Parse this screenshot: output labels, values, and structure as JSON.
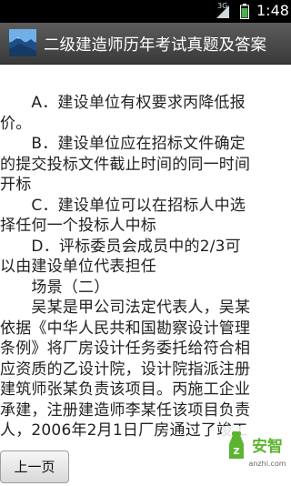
{
  "status_bar": {
    "network_label": "3G",
    "time": "1:48"
  },
  "title_bar": {
    "title": "二级建造师历年考试真题及答案"
  },
  "article": {
    "lines": [
      "　　A．建设单位有权要求丙降低报",
      "价。",
      "　　B．建设单位应在招标文件确定",
      "的提交投标文件截止时间的同一时间",
      "开标",
      "　　C．建设单位可以在招标人中选",
      "择任何一个投标人中标",
      "　　D．评标委员会成员中的2/3可",
      "以由建设单位代表担任",
      "　　场景（二）",
      "　　吴某是甲公司法定代表人，吴某",
      "依据《中华人民共和国勘察设计管理",
      "条例》将厂房设计任务委托给符合相",
      "应资质的乙设计院，设计院指派注册",
      "建筑师张某负责该项目。丙施工企业",
      "承建，注册建造师李某任该项目负责",
      "人，2006年2月1日厂房通过了竣工"
    ]
  },
  "bottom_bar": {
    "prev_label": "上一页"
  },
  "watermark": {
    "brand": "安智",
    "domain": "anzhi.com"
  },
  "colors": {
    "status_bg": "#000000",
    "title_bar": "#4a4a4a",
    "text": "#222222",
    "battery": "#4caf50",
    "watermark_green": "#5cb531"
  }
}
